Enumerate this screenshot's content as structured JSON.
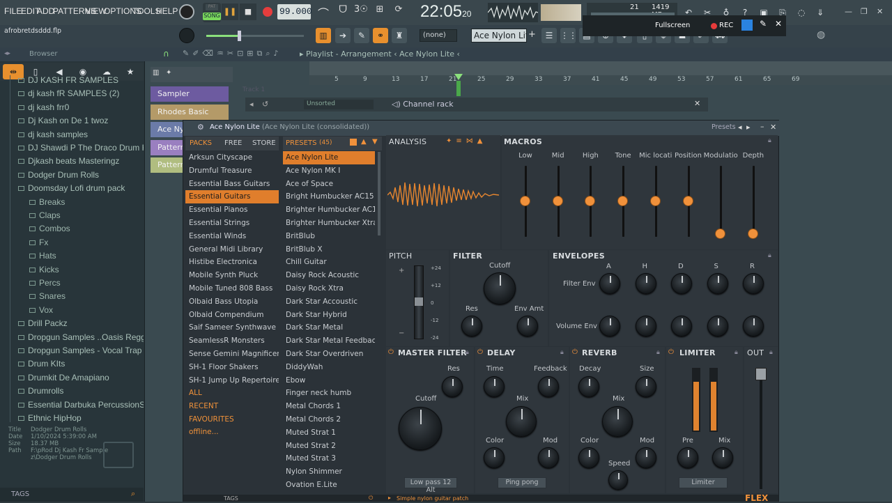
{
  "menu": {
    "items": [
      "FILE",
      "EDIT",
      "ADD",
      "PATTERNS",
      "VIEW",
      "OPTIONS",
      "TOOLS",
      "HELP"
    ]
  },
  "transport": {
    "mode_label": "SONG",
    "tempo": "99.000",
    "time": "22:05",
    "time_sub": "20",
    "cpu": "21",
    "mem": "1419 MB",
    "fullscreen_label": "Fullscreen",
    "rec_label": "REC"
  },
  "project": {
    "filename": "afrobretdsddd.flp"
  },
  "channel": {
    "pattern": "(none)",
    "instrument": "Ace Nylon Lite"
  },
  "browser": {
    "title": "Browser",
    "items": [
      {
        "label": "DJ KASH FR SAMPLES",
        "sub": false
      },
      {
        "label": "dj kash fR SAMPLES (2)",
        "sub": false
      },
      {
        "label": "dj kash frr0",
        "sub": false
      },
      {
        "label": "Dj Kash on De 1 twoz",
        "sub": false
      },
      {
        "label": "dj kash samples",
        "sub": false
      },
      {
        "label": "DJ Shawdi P The Draco Drum Kit",
        "sub": false
      },
      {
        "label": "Djkash beats Masteringz",
        "sub": false
      },
      {
        "label": "Dodger Drum Rolls",
        "sub": false
      },
      {
        "label": "Doomsday Lofi drum pack",
        "sub": false
      },
      {
        "label": "Breaks",
        "sub": true
      },
      {
        "label": "Claps",
        "sub": true
      },
      {
        "label": "Combos",
        "sub": true
      },
      {
        "label": "Fx",
        "sub": true
      },
      {
        "label": "Hats",
        "sub": true
      },
      {
        "label": "Kicks",
        "sub": true
      },
      {
        "label": "Percs",
        "sub": true
      },
      {
        "label": "Snares",
        "sub": true
      },
      {
        "label": "Vox",
        "sub": true
      },
      {
        "label": "Drill Packz",
        "sub": false
      },
      {
        "label": "Dropgun Samples ..Oasis Reggaeton",
        "sub": false
      },
      {
        "label": "Dropgun Samples - Vocal Trap",
        "sub": false
      },
      {
        "label": "Drum KIts",
        "sub": false
      },
      {
        "label": "Drumkit De Amapiano",
        "sub": false
      },
      {
        "label": "Drumrolls",
        "sub": false
      },
      {
        "label": "Essential Darbuka PercussionS",
        "sub": false
      },
      {
        "label": "Ethnic HipHop",
        "sub": false
      }
    ],
    "info": {
      "title_k": "Title",
      "title_v": "Dodger Drum Rolls",
      "date_k": "Date",
      "date_v": "1/10/2024 5:39:00 AM",
      "size_k": "Size",
      "size_v": "18.37 MB",
      "path_k": "Path",
      "path_v": "F:\\pRod Dj Kash Fr Samplez\\Dodger Drum Rolls"
    },
    "tags_label": "TAGS"
  },
  "playlist": {
    "title": "Playlist - Arrangement",
    "crumb": "Ace Nylon Lite",
    "track1": "Track 1",
    "bars": [
      "5",
      "9",
      "13",
      "17",
      "21",
      "25",
      "29",
      "33",
      "37",
      "41",
      "45",
      "49",
      "53",
      "57",
      "61",
      "65",
      "69"
    ],
    "channels": [
      "Sampler",
      "Rhodes Basic",
      "Ace Ny",
      "Pattern",
      "Pattern"
    ]
  },
  "channel_rack": {
    "title": "Channel rack",
    "filter": "Unsorted"
  },
  "flex": {
    "title": "Ace Nylon Lite",
    "subtitle": "(Ace Nylon Lite (consolidated))",
    "presets_btn": "Presets",
    "tabs": {
      "packs": "PACKS",
      "free": "FREE",
      "store": "STORE",
      "presets": "PRESETS",
      "preset_count": "(45)"
    },
    "packs": [
      "Arksun Cityscape",
      "Drumful Treasure",
      "Essential Bass Guitars",
      "Essential Guitars",
      "Essential Pianos",
      "Essential Strings",
      "Essential Winds",
      "General Midi Library",
      "Histibe Electronica",
      "Mobile Synth Pluck",
      "Mobile Tuned 808 Bass",
      "Olbaid Bass Utopia",
      "Olbaid Compendium",
      "Saif Sameer Synthwave",
      "SeamlessR Monsters",
      "Sense Gemini Magnificence",
      "SH-1 Floor Shakers",
      "SH-1 Jump Up Repertoire"
    ],
    "pack_filters": [
      "ALL",
      "RECENT",
      "FAVOURITES",
      "offline..."
    ],
    "presets": [
      "Ace Nylon Lite",
      "Ace Nylon MK I",
      "Ace of Space",
      "Bright Humbucker AC15",
      "Brighter Humbucker AC15",
      "Brighter Humbucker Xtra",
      "BritBlub",
      "BritBlub X",
      "Chill Guitar",
      "Daisy Rock Acoustic",
      "Daisy Rock Xtra",
      "Dark Star Accoustic",
      "Dark Star Hybrid",
      "Dark Star Metal",
      "Dark Star Metal Feedback",
      "Dark Star Overdriven",
      "DiddyWah",
      "Ebow",
      "Finger neck humb",
      "Metal Chords 1",
      "Metal Chords 2",
      "Muted Strat 1",
      "Muted Strat 2",
      "Muted Strat 3",
      "Nylon Shimmer",
      "Ovation E.Lite"
    ],
    "analysis": "ANALYSIS",
    "macros": {
      "title": "MACROS",
      "labels": [
        "Low",
        "Mid",
        "High",
        "Tone",
        "Mic locati",
        "Position",
        "Modulatio",
        "Depth"
      ],
      "values": [
        0.5,
        0.5,
        0.5,
        0.5,
        0.5,
        0.5,
        0.0,
        0.0
      ]
    },
    "pitch": {
      "title": "PITCH",
      "scale": [
        "+24",
        "+12",
        "0",
        "-12",
        "-24"
      ],
      "plus": "+",
      "minus": "−"
    },
    "filter": {
      "title": "FILTER",
      "cutoff": "Cutoff",
      "res": "Res",
      "env": "Env Amt"
    },
    "envelopes": {
      "title": "ENVELOPES",
      "cols": [
        "A",
        "H",
        "D",
        "S",
        "R"
      ],
      "rows": [
        "Filter Env",
        "Volume Env"
      ]
    },
    "master_filter": {
      "title": "MASTER FILTER",
      "res": "Res",
      "cutoff": "Cutoff",
      "type": "Low pass 12 Alt"
    },
    "delay": {
      "title": "DELAY",
      "time": "Time",
      "feedback": "Feedback",
      "mix": "Mix",
      "color": "Color",
      "mod": "Mod",
      "mode": "Ping pong"
    },
    "reverb": {
      "title": "REVERB",
      "decay": "Decay",
      "size": "Size",
      "mix": "Mix",
      "color": "Color",
      "mod": "Mod",
      "speed": "Speed"
    },
    "limiter": {
      "title": "LIMITER",
      "pre": "Pre",
      "mix": "Mix",
      "mode": "Limiter"
    },
    "out": {
      "title": "OUT"
    },
    "status": "Simple nylon guitar patch",
    "footer_tags": "TAGS",
    "brand": "FLEX"
  },
  "colors": {
    "accent": "#f0913b",
    "panel": "#2b3238",
    "browser_text": "#a9c0b8"
  }
}
